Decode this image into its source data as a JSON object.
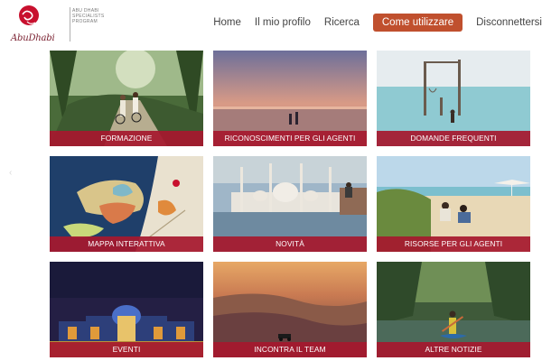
{
  "header": {
    "logo": {
      "wordmark": "AbuDhabi",
      "tagline_lines": [
        "ABU DHABI",
        "SPECIALISTS",
        "PROGRAM"
      ]
    },
    "nav": [
      {
        "label": "Home"
      },
      {
        "label": "Il mio profilo"
      },
      {
        "label": "Ricerca"
      }
    ],
    "cta_label": "Come utilizzare",
    "logout_label": "Disconnettersi",
    "colors": {
      "accent": "#c0502e",
      "brand": "#a6192e"
    }
  },
  "tiles": [
    {
      "caption": "FORMAZIONE",
      "image": "cyclists-on-tropical-path"
    },
    {
      "caption": "RICONOSCIMENTI PER GLI AGENTI",
      "image": "couple-on-beach-at-dusk"
    },
    {
      "caption": "DOMANDE FREQUENTI",
      "image": "woman-on-sea-swing"
    },
    {
      "caption": "MAPPA INTERATTIVA",
      "image": "abu-dhabi-island-map"
    },
    {
      "caption": "NOVITÀ",
      "image": "grand-mosque-reflection"
    },
    {
      "caption": "RISORSE PER GLI AGENTI",
      "image": "couple-on-beach-sand"
    },
    {
      "caption": "EVENTI",
      "image": "palace-lit-at-night"
    },
    {
      "caption": "INCONTRA IL TEAM",
      "image": "desert-dunes-sunset"
    },
    {
      "caption": "ALTRE NOTIZIE",
      "image": "kayaker-in-mangroves"
    }
  ]
}
